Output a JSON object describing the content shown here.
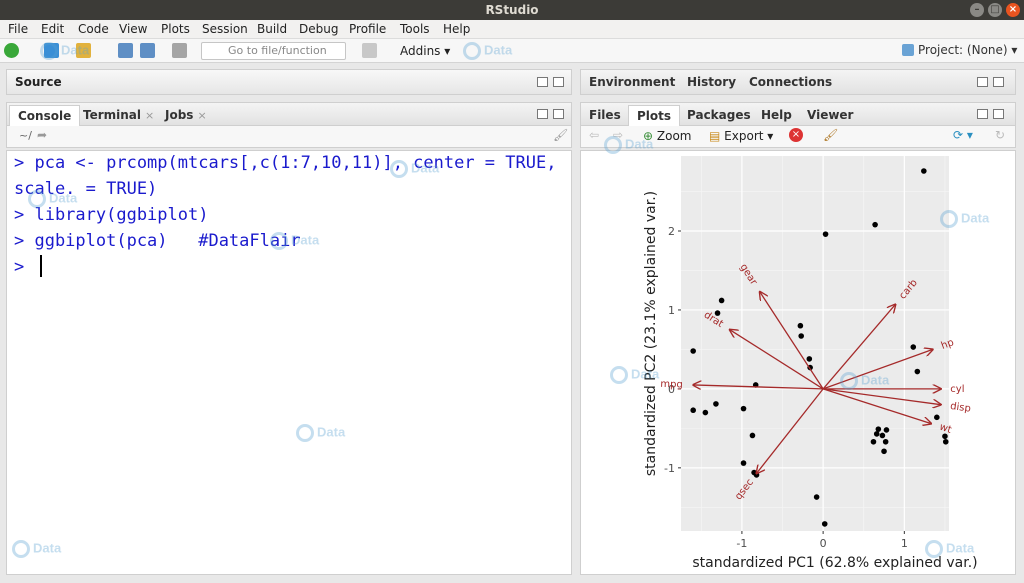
{
  "window": {
    "title": "RStudio"
  },
  "menu": [
    "File",
    "Edit",
    "Code",
    "View",
    "Plots",
    "Session",
    "Build",
    "Debug",
    "Profile",
    "Tools",
    "Help"
  ],
  "toolbar": {
    "goto_placeholder": "Go to file/function",
    "addins_label": "Addins",
    "project_label": "Project: (None)"
  },
  "source_pane": {
    "title": "Source"
  },
  "console_tabs": [
    {
      "label": "Console",
      "active": true
    },
    {
      "label": "Terminal",
      "closable": true
    },
    {
      "label": "Jobs",
      "closable": true
    }
  ],
  "console": {
    "path": "~/",
    "lines": [
      "> pca <- prcomp(mtcars[,c(1:7,10,11)], center = TRUE,",
      "scale. = TRUE)",
      "> library(ggbiplot)",
      "> ggbiplot(pca)   #DataFlair",
      "> "
    ]
  },
  "env_tabs": [
    "Environment",
    "History",
    "Connections"
  ],
  "files_tabs": [
    {
      "label": "Files"
    },
    {
      "label": "Plots",
      "active": true
    },
    {
      "label": "Packages"
    },
    {
      "label": "Help"
    },
    {
      "label": "Viewer"
    }
  ],
  "plots_toolbar": {
    "zoom_label": "Zoom",
    "export_label": "Export"
  },
  "watermark": {
    "line1": "Data",
    "line2": "Flair"
  },
  "chart_data": {
    "type": "scatter",
    "xlabel": "standardized PC1 (62.8% explained var.)",
    "ylabel": "standardized PC2 (23.1% explained var.)",
    "xlim": [
      -1.75,
      1.55
    ],
    "ylim": [
      -1.8,
      2.95
    ],
    "xticks": [
      -1,
      0,
      1
    ],
    "yticks": [
      -1,
      0,
      1,
      2
    ],
    "points": [
      [
        -1.6,
        0.48
      ],
      [
        -1.25,
        1.12
      ],
      [
        -1.3,
        0.96
      ],
      [
        -1.6,
        -0.27
      ],
      [
        -1.45,
        -0.3
      ],
      [
        -1.32,
        -0.19
      ],
      [
        -0.83,
        0.05
      ],
      [
        -0.98,
        -0.25
      ],
      [
        -0.87,
        -0.59
      ],
      [
        -0.98,
        -0.94
      ],
      [
        -0.82,
        -1.09
      ],
      [
        -0.85,
        -1.06
      ],
      [
        -0.28,
        0.8
      ],
      [
        -0.27,
        0.67
      ],
      [
        -0.17,
        0.38
      ],
      [
        -0.16,
        0.27
      ],
      [
        0.03,
        1.96
      ],
      [
        0.64,
        2.08
      ],
      [
        1.24,
        2.76
      ],
      [
        1.11,
        0.53
      ],
      [
        1.16,
        0.22
      ],
      [
        1.4,
        -0.36
      ],
      [
        1.5,
        -0.6
      ],
      [
        1.51,
        -0.67
      ],
      [
        0.62,
        -0.67
      ],
      [
        0.66,
        -0.57
      ],
      [
        0.68,
        -0.51
      ],
      [
        0.73,
        -0.59
      ],
      [
        0.77,
        -0.67
      ],
      [
        0.78,
        -0.52
      ],
      [
        0.75,
        -0.79
      ],
      [
        -0.08,
        -1.37
      ],
      [
        0.02,
        -1.71
      ]
    ],
    "arrows": [
      {
        "name": "mpg",
        "x": -1.6,
        "y": 0.05
      },
      {
        "name": "cyl",
        "x": 1.45,
        "y": 0.0
      },
      {
        "name": "disp",
        "x": 1.45,
        "y": -0.2
      },
      {
        "name": "hp",
        "x": 1.35,
        "y": 0.5
      },
      {
        "name": "drat",
        "x": -1.15,
        "y": 0.75
      },
      {
        "name": "wt",
        "x": 1.33,
        "y": -0.44
      },
      {
        "name": "qsec",
        "x": -0.82,
        "y": -1.07
      },
      {
        "name": "gear",
        "x": -0.78,
        "y": 1.23
      },
      {
        "name": "carb",
        "x": 0.89,
        "y": 1.07
      }
    ],
    "colors": {
      "arrow": "#a52a2a",
      "point": "#000000",
      "panel": "#ebebeb",
      "grid": "#ffffff"
    }
  }
}
